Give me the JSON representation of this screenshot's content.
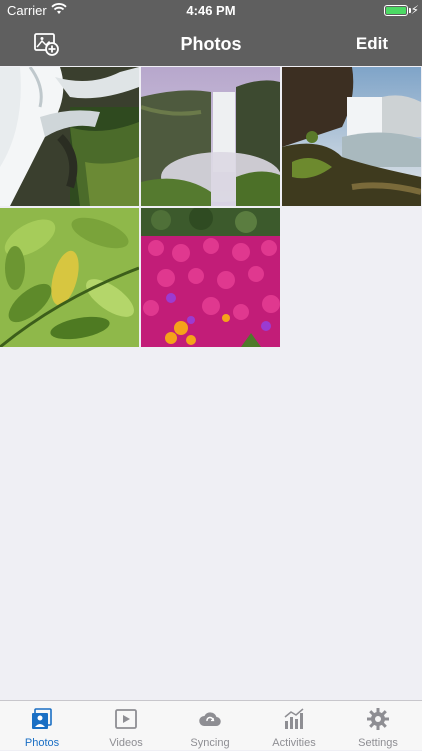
{
  "status_bar": {
    "carrier": "Carrier",
    "time": "4:46 PM"
  },
  "nav_bar": {
    "title": "Photos",
    "edit_label": "Edit",
    "add_icon": "add-photo-icon"
  },
  "photos": [
    {
      "subject": "waterfall-closeup"
    },
    {
      "subject": "waterfall-misty-cliff"
    },
    {
      "subject": "waterfall-coast"
    },
    {
      "subject": "green-leaves"
    },
    {
      "subject": "pink-flowers"
    }
  ],
  "tab_bar": {
    "active": "photos",
    "tabs": [
      {
        "label": "Photos",
        "icon": "photos-icon"
      },
      {
        "label": "Videos",
        "icon": "videos-icon"
      },
      {
        "label": "Syncing",
        "icon": "cloud-sync-icon"
      },
      {
        "label": "Activities",
        "icon": "chart-icon"
      },
      {
        "label": "Settings",
        "icon": "gear-icon"
      }
    ]
  },
  "colors": {
    "bar_background": "#5f5f5f",
    "content_background": "#efeff4",
    "tab_active": "#1a6fc4",
    "tab_inactive": "#8e8e93",
    "battery": "#4cd964"
  }
}
